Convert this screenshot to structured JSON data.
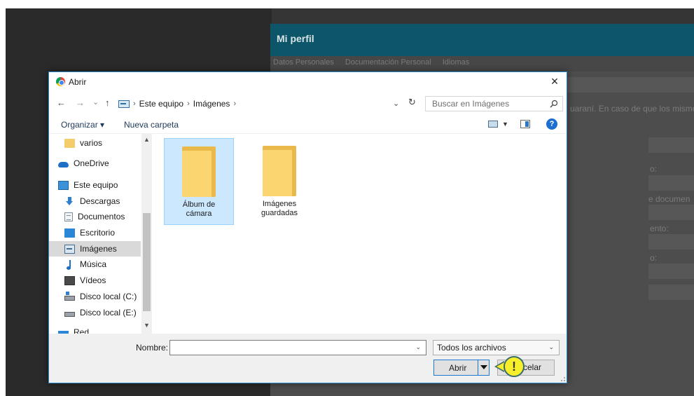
{
  "web_page": {
    "title": "Mi perfil",
    "tabs": [
      "Datos Personales",
      "Documentación Personal",
      "Idiomas"
    ],
    "snippet_text": "uaraní. En caso de que los mismo",
    "field_labels": [
      "o:",
      "e documen",
      "ento:",
      "o:"
    ],
    "modal_close": "×"
  },
  "dialog": {
    "title": "Abrir",
    "close_symbol": "×",
    "nav": {
      "back": "←",
      "forward": "→",
      "recent": "⌄",
      "up": "↑"
    },
    "breadcrumb": [
      "Este equipo",
      "Imágenes"
    ],
    "breadcrumb_sep": "›",
    "address_dropdown": "⌄",
    "refresh_symbol": "↻",
    "search_placeholder": "Buscar en Imágenes",
    "toolbar": {
      "organize": "Organizar ▾",
      "new_folder": "Nueva carpeta",
      "view_dropdown": "▼",
      "help": "?"
    },
    "nav_pane": [
      {
        "label": "varios",
        "icon": "folder-icon"
      },
      {
        "label": "OneDrive",
        "icon": "onedrive-icon"
      },
      {
        "label": "Este equipo",
        "icon": "computer-icon"
      },
      {
        "label": "Descargas",
        "icon": "download-icon"
      },
      {
        "label": "Documentos",
        "icon": "documents-icon"
      },
      {
        "label": "Escritorio",
        "icon": "desktop-icon"
      },
      {
        "label": "Imágenes",
        "icon": "pictures-icon",
        "selected": true
      },
      {
        "label": "Música",
        "icon": "music-icon"
      },
      {
        "label": "Vídeos",
        "icon": "videos-icon"
      },
      {
        "label": "Disco local (C:)",
        "icon": "drive-icon"
      },
      {
        "label": "Disco local (E:)",
        "icon": "drive-icon"
      },
      {
        "label": "Red",
        "icon": "network-icon"
      }
    ],
    "scroll": {
      "up": "▲",
      "down": "▼"
    },
    "files": [
      {
        "name_line1": "Álbum de",
        "name_line2": "cámara",
        "selected": true
      },
      {
        "name_line1": "Imágenes",
        "name_line2": "guardadas",
        "selected": false
      }
    ],
    "bottom": {
      "name_label": "Nombre:",
      "name_value": "",
      "name_dropdown": "⌄",
      "filter": "Todos los archivos",
      "filter_dropdown": "⌄",
      "open_label": "Abrir",
      "cancel_label": "celar"
    }
  },
  "marker": {
    "symbol": "!"
  },
  "colors": {
    "accent": "#0d5568",
    "dialog_border": "#2b8ac8",
    "selection": "#cce8ff",
    "marker": "#f8ef2c"
  }
}
